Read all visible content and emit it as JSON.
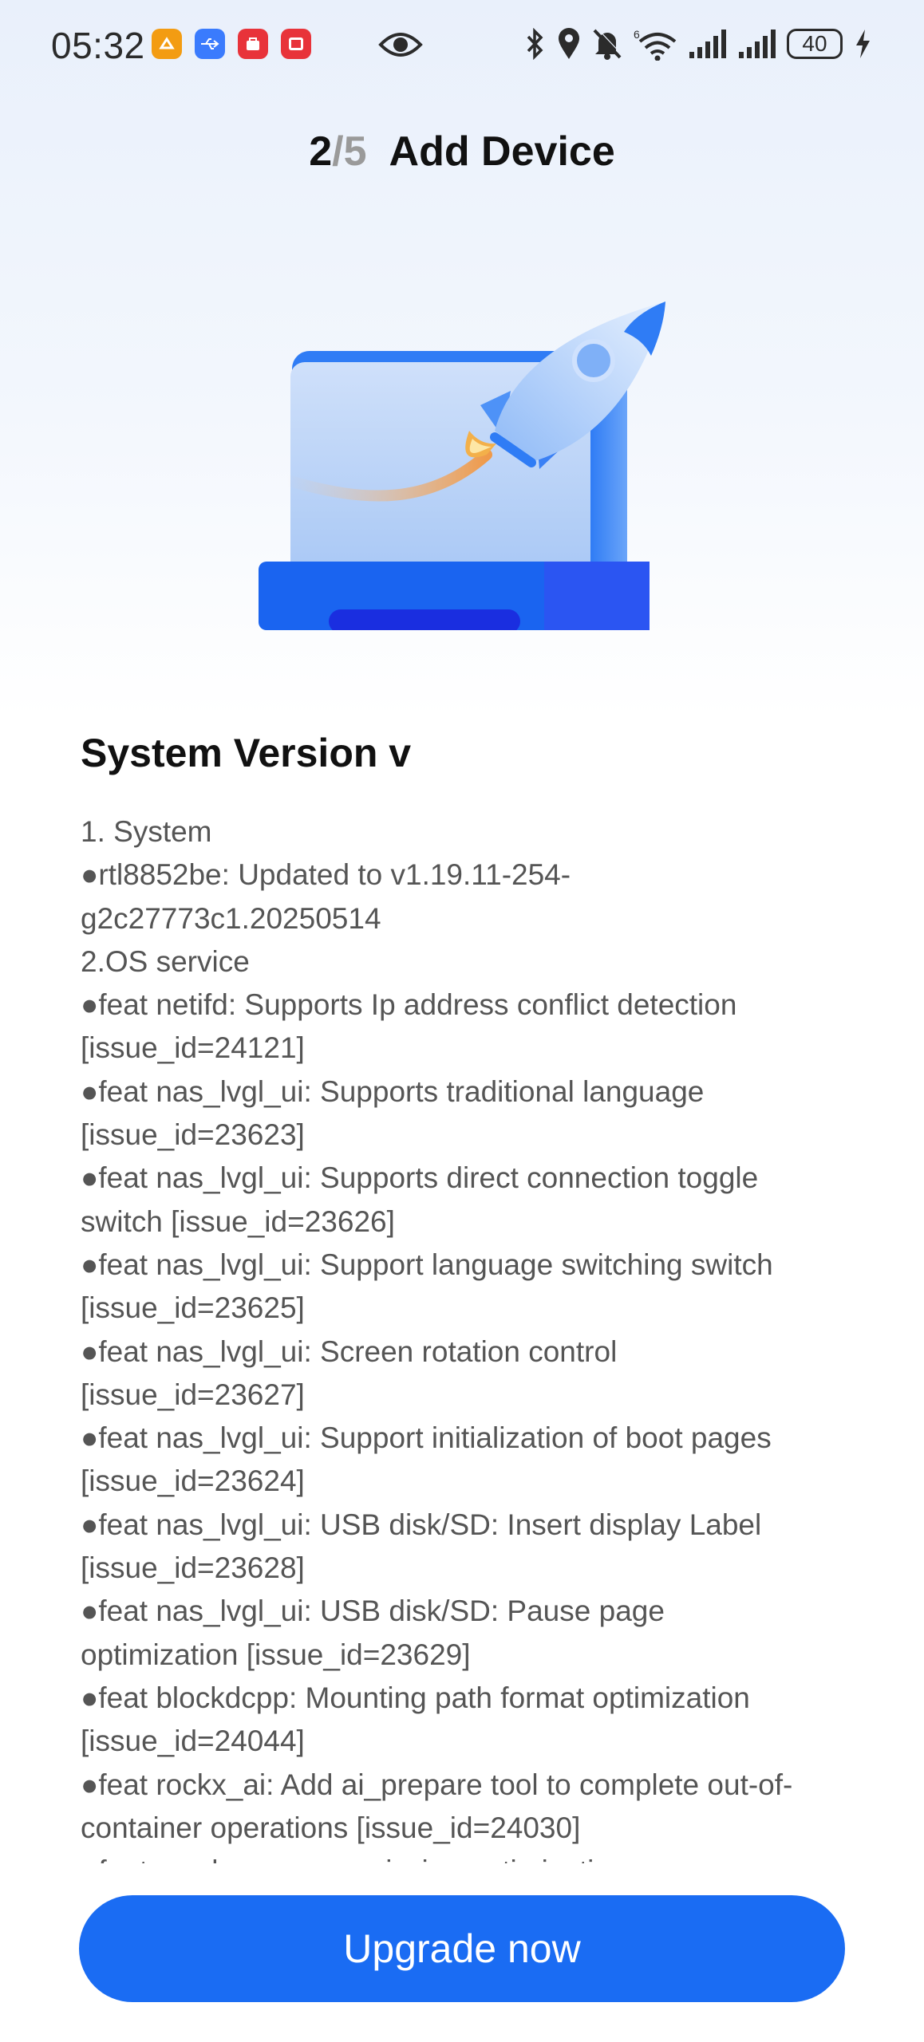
{
  "status_bar": {
    "time": "05:32",
    "battery": "40",
    "app_icons": [
      "orange-app-icon",
      "usb-icon",
      "huawei-app-icon",
      "red-app-icon"
    ],
    "right_icons": [
      "bluetooth-icon",
      "location-icon",
      "mute-icon",
      "wifi-6-icon",
      "signal-icon",
      "signal-icon-2",
      "battery-icon",
      "charging-icon"
    ],
    "colors": {
      "orange": "#f39c12",
      "blue": "#3a7bfd",
      "red": "#e8333a"
    }
  },
  "header": {
    "step_current": "2",
    "step_separator": "/",
    "step_total": "5",
    "title": "Add Device"
  },
  "section": {
    "title": "System Version v"
  },
  "notes": [
    "1. System",
    "●rtl8852be: Updated to v1.19.11-254-",
    "g2c27773c1.20250514",
    "2.OS service",
    "●feat netifd: Supports Ip address conflict detection",
    "[issue_id=24121]",
    "●feat nas_lvgl_ui: Supports traditional language",
    "[issue_id=23623]",
    "●feat nas_lvgl_ui: Supports direct connection toggle",
    "switch [issue_id=23626]",
    "●feat nas_lvgl_ui: Support language switching switch",
    "[issue_id=23625]",
    "●feat nas_lvgl_ui: Screen rotation control",
    "[issue_id=23627]",
    "●feat nas_lvgl_ui: Support initialization of boot pages",
    "[issue_id=23624]",
    "●feat nas_lvgl_ui: USB disk/SD: Insert display Label",
    "[issue_id=23628]",
    "●feat nas_lvgl_ui: USB disk/SD: Pause page",
    "optimization [issue_id=23629]",
    "●feat blockdcpp: Mounting path format optimization",
    "[issue_id=24044]",
    "●feat rockx_ai: Add ai_prepare tool to complete out-of-",
    "container operations [issue_id=24030]",
    "●feat samba user permission optimization"
  ],
  "button": {
    "label": "Upgrade now",
    "color": "#1a6cf3"
  }
}
